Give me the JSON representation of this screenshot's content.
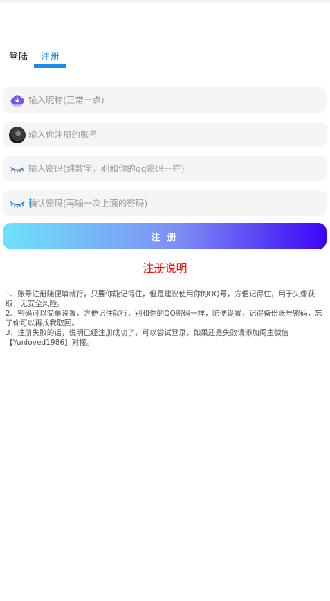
{
  "tabs": {
    "login": "登陆",
    "register": "注册"
  },
  "form": {
    "nickname_placeholder": "输入昵称(正常一点)",
    "account_placeholder": "输入你注册的账号",
    "password_placeholder": "输入密码(纯数字，别和你的qq密码一样)",
    "confirm_placeholder": "确认密码(再输一次上面的密码)",
    "submit_label": "注 册"
  },
  "notes": {
    "title": "注册说明",
    "items": [
      "1、账号注册随便填就行，只要你能记得住，但是建议使用你的QQ号，方便记得住，用于头像获取，无安全风险。",
      "2、密码可以简单设置，方便记住就行，别和你的QQ密码一样，随便设置，记得备份账号密码，忘了你可以再找我取回。",
      "3、注册失败的话，说明已经注册成功了，可以尝试登录，如果还是失败请添加阁主微信【Yunloved1986】对接。"
    ]
  },
  "icons": {
    "nickname": "cloud-download-icon",
    "account": "avatar",
    "password": "closed-eye-icon",
    "confirm": "closed-eye-icon"
  },
  "colors": {
    "accent": "#1f8be8",
    "notes_title": "#e8120c",
    "gradient_start": "#6fe3fb",
    "gradient_end": "#3a05f5"
  }
}
